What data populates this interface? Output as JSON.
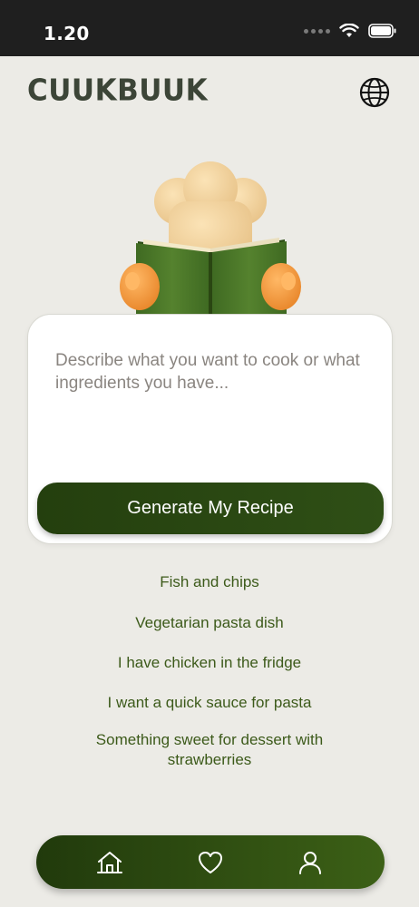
{
  "status_bar": {
    "time": "1.20",
    "icons": [
      "signal-dots-icon",
      "wifi-icon",
      "battery-icon"
    ]
  },
  "header": {
    "logo_text": "CUUKBUUK",
    "language_icon": "globe-icon"
  },
  "mascot": {
    "description_icon": "chef-reading-book-icon"
  },
  "prompt": {
    "placeholder": "Describe what you want to cook or what ingredients you have...",
    "value": "",
    "generate_label": "Generate My Recipe"
  },
  "suggestions": [
    "Fish and chips",
    "Vegetarian pasta dish",
    "I have chicken in the fridge",
    "I want a quick sauce for pasta",
    "Something sweet for dessert with strawberries"
  ],
  "tab_bar": {
    "tabs": [
      "home-icon",
      "heart-icon",
      "profile-icon"
    ]
  },
  "colors": {
    "background": "#ECEBE6",
    "brand_green_dark": "#243F0E",
    "brand_green": "#3C6016",
    "suggestion_text": "#3C5A1A",
    "logo": "#3C4537"
  }
}
